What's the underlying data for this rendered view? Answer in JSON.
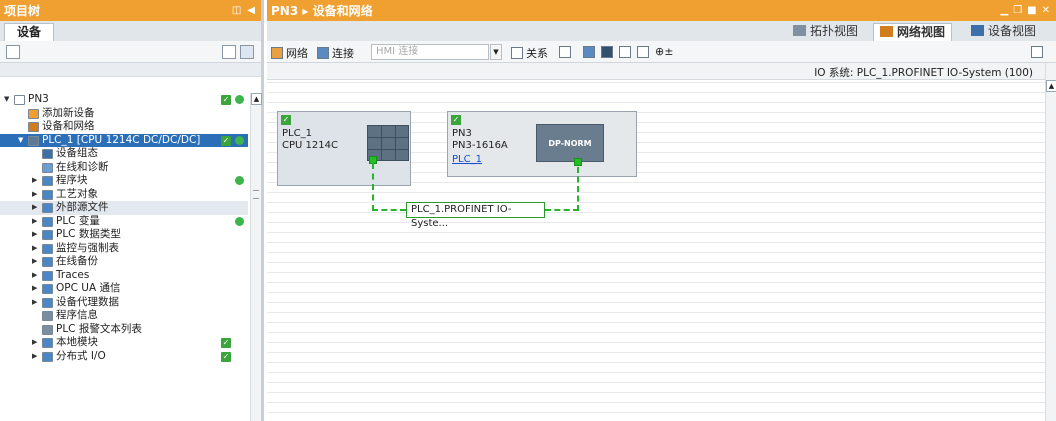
{
  "left": {
    "title": "项目树",
    "tab": "设备",
    "tree": [
      {
        "label": "PN3",
        "indent": 0,
        "tri": "▼",
        "icon": "project-icon",
        "chk": true,
        "dot": true
      },
      {
        "label": "添加新设备",
        "indent": 1,
        "tri": "",
        "icon": "add-device-icon"
      },
      {
        "label": "设备和网络",
        "indent": 1,
        "tri": "",
        "icon": "network-icon"
      },
      {
        "label": "PLC_1 [CPU 1214C DC/DC/DC]",
        "indent": 1,
        "tri": "▼",
        "icon": "plc-icon",
        "sel": true,
        "chk": true,
        "dot": true
      },
      {
        "label": "设备组态",
        "indent": 2,
        "tri": "",
        "icon": "device-config-icon"
      },
      {
        "label": "在线和诊断",
        "indent": 2,
        "tri": "",
        "icon": "diagnostics-icon"
      },
      {
        "label": "程序块",
        "indent": 2,
        "tri": "▶",
        "icon": "folder-icon",
        "dot": true
      },
      {
        "label": "工艺对象",
        "indent": 2,
        "tri": "▶",
        "icon": "folder-icon"
      },
      {
        "label": "外部源文件",
        "indent": 2,
        "tri": "▶",
        "icon": "folder-icon",
        "hl": true
      },
      {
        "label": "PLC 变量",
        "indent": 2,
        "tri": "▶",
        "icon": "folder-icon",
        "dot": true
      },
      {
        "label": "PLC 数据类型",
        "indent": 2,
        "tri": "▶",
        "icon": "folder-icon"
      },
      {
        "label": "监控与强制表",
        "indent": 2,
        "tri": "▶",
        "icon": "folder-icon"
      },
      {
        "label": "在线备份",
        "indent": 2,
        "tri": "▶",
        "icon": "folder-icon"
      },
      {
        "label": "Traces",
        "indent": 2,
        "tri": "▶",
        "icon": "folder-icon"
      },
      {
        "label": "OPC UA 通信",
        "indent": 2,
        "tri": "▶",
        "icon": "folder-icon"
      },
      {
        "label": "设备代理数据",
        "indent": 2,
        "tri": "▶",
        "icon": "folder-icon"
      },
      {
        "label": "程序信息",
        "indent": 2,
        "tri": "",
        "icon": "info-icon"
      },
      {
        "label": "PLC 报警文本列表",
        "indent": 2,
        "tri": "",
        "icon": "list-icon"
      },
      {
        "label": "本地模块",
        "indent": 2,
        "tri": "▶",
        "icon": "folder-icon",
        "chk": true
      },
      {
        "label": "分布式 I/O",
        "indent": 2,
        "tri": "▶",
        "icon": "folder-icon",
        "chk": true
      }
    ]
  },
  "right": {
    "breadcrumb": "PN3 ▸ 设备和网络",
    "view_tabs": [
      "拓扑视图",
      "网络视图",
      "设备视图"
    ],
    "toolbar": {
      "network": "网络",
      "connect": "连接",
      "hmi_placeholder": "HMI 连接",
      "relation": "关系"
    },
    "system_label": "IO 系统: PLC_1.PROFINET IO-System (100)",
    "devices": {
      "plc": {
        "name": "PLC_1",
        "model": "CPU 1214C"
      },
      "pn3": {
        "name": "PN3",
        "model": "PN3-1616A",
        "link": "PLC_1",
        "module": "DP-NORM"
      }
    },
    "network_label": "PLC_1.PROFINET IO-Syste..."
  },
  "colors": {
    "accent": "#f0a030",
    "selection": "#2a6fb7",
    "network": "#28b428"
  }
}
